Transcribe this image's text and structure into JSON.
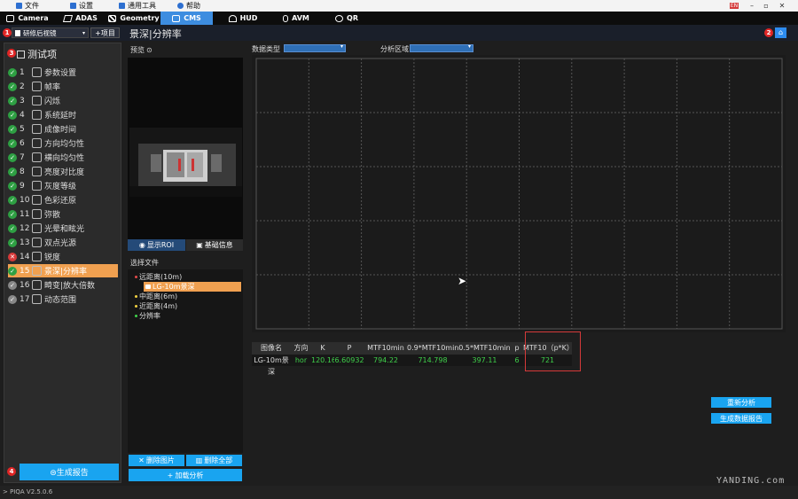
{
  "menu": {
    "items": [
      {
        "label": "文件",
        "icon": "file-icon"
      },
      {
        "label": "设置",
        "icon": "tools-icon"
      },
      {
        "label": "通用工具",
        "icon": "toolbox-icon"
      },
      {
        "label": "帮助",
        "icon": "help-icon"
      }
    ],
    "lang_badge": "EN"
  },
  "tabs": [
    {
      "label": "Camera",
      "icon": "camera-icon"
    },
    {
      "label": "ADAS",
      "icon": "adas-icon"
    },
    {
      "label": "Geometry",
      "icon": "geometry-icon"
    },
    {
      "label": "CMS",
      "icon": "cms-icon",
      "active": true
    },
    {
      "label": "HUD",
      "icon": "hud-icon"
    },
    {
      "label": "AVM",
      "icon": "avm-icon"
    },
    {
      "label": "QR",
      "icon": "qr-icon"
    }
  ],
  "toolbar": {
    "preset": "研修后视镜",
    "add_item": "+项目",
    "page_title": "景深|分辨率",
    "badges": [
      "1",
      "2",
      "3",
      "4"
    ]
  },
  "tests": {
    "header": "测试项",
    "items": [
      {
        "num": "1",
        "label": "参数设置",
        "status": "ok"
      },
      {
        "num": "2",
        "label": "帧率",
        "status": "ok"
      },
      {
        "num": "3",
        "label": "闪烁",
        "status": "ok"
      },
      {
        "num": "4",
        "label": "系统延时",
        "status": "ok"
      },
      {
        "num": "5",
        "label": "成像时间",
        "status": "ok"
      },
      {
        "num": "6",
        "label": "方向均匀性",
        "status": "ok"
      },
      {
        "num": "7",
        "label": "横向均匀性",
        "status": "ok"
      },
      {
        "num": "8",
        "label": "亮度对比度",
        "status": "ok"
      },
      {
        "num": "9",
        "label": "灰度等级",
        "status": "ok"
      },
      {
        "num": "10",
        "label": "色彩还原",
        "status": "ok"
      },
      {
        "num": "11",
        "label": "弥散",
        "status": "ok"
      },
      {
        "num": "12",
        "label": "光晕和眩光",
        "status": "ok"
      },
      {
        "num": "13",
        "label": "双点光源",
        "status": "ok"
      },
      {
        "num": "14",
        "label": "锐度",
        "status": "fail"
      },
      {
        "num": "15",
        "label": "景深|分辨率",
        "status": "ok",
        "selected": true
      },
      {
        "num": "16",
        "label": "畸变|放大倍数",
        "status": "pending"
      },
      {
        "num": "17",
        "label": "动态范围",
        "status": "pending"
      }
    ],
    "report_button": "⊜生成报告"
  },
  "preview": {
    "label": "预览",
    "show_roi": "显示ROI",
    "basic_info": "基础信息",
    "file_label": "选择文件",
    "tree": [
      {
        "label": "远距离(10m)",
        "color": "#e34a4a",
        "level": 0
      },
      {
        "label": "LG-10m景深",
        "color": "#f0a050",
        "level": 1,
        "selected": true
      },
      {
        "label": "中距离(6m)",
        "color": "#f0d040",
        "level": 0
      },
      {
        "label": "近距离(4m)",
        "color": "#f0d040",
        "level": 0
      },
      {
        "label": "分辨率",
        "color": "#3fd04a",
        "level": 0
      }
    ],
    "delete_image": "删除图片",
    "delete_all": "删除全部",
    "load_analysis": "加载分析"
  },
  "filters": {
    "data_type_label": "数据类型",
    "data_type_value": "",
    "region_label": "分析区域",
    "region_value": ""
  },
  "chart_data": {
    "type": "line",
    "title": "",
    "xlabel": "",
    "ylabel": "",
    "series": [],
    "grid": true,
    "ylim": [
      0,
      5
    ],
    "xlim": [
      0,
      10
    ]
  },
  "table": {
    "headers": [
      "图像名",
      "方向",
      "K",
      "P",
      "MTF10min",
      "0.9*MTF10min",
      "0.5*MTF10min",
      "p",
      "MTF10（p*K）"
    ],
    "rows": [
      [
        "LG-10m景深",
        "hor",
        "120.167",
        "6.60932",
        "794.22",
        "714.798",
        "397.11",
        "6",
        "721"
      ]
    ]
  },
  "actions": {
    "reanalyze": "重新分析",
    "generate_report": "生成数据报告"
  },
  "status": {
    "version": "> PIQA V2.5.0.6"
  },
  "watermark": "YANDING.com"
}
